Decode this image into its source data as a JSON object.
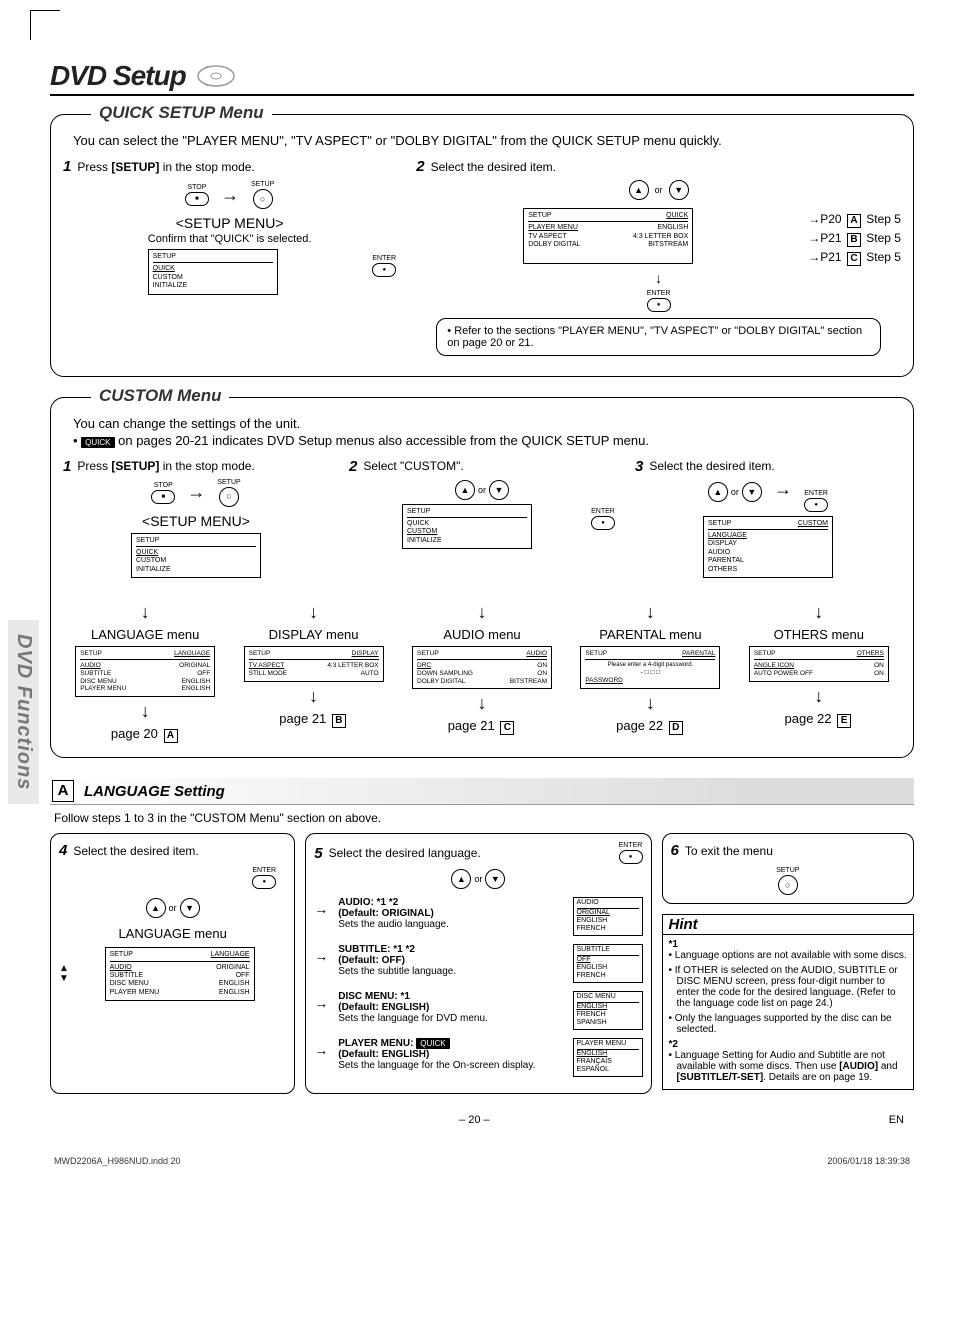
{
  "page": {
    "title": "DVD Setup",
    "sidebar": "DVD Functions",
    "footer_page": "– 20 –",
    "footer_lang": "EN",
    "footer_file": "MWD2206A_H986NUD.indd   20",
    "footer_ts": "2006/01/18   18:39:38"
  },
  "quick": {
    "title": "QUICK SETUP Menu",
    "intro": "You can select the \"PLAYER MENU\", \"TV ASPECT\" or \"DOLBY DIGITAL\" from the QUICK SETUP menu quickly.",
    "step1_num": "1",
    "step1_text_a": "Press ",
    "step1_bold": "[SETUP]",
    "step1_text_b": " in the stop mode.",
    "stop_label": "STOP",
    "setup_label": "SETUP",
    "enter_label": "ENTER",
    "menu_title": "<SETUP MENU>",
    "confirm": "Confirm that \"QUICK\" is selected.",
    "osd1_hdr": "SETUP",
    "osd1_items": [
      "QUICK",
      "CUSTOM",
      "INITIALIZE"
    ],
    "step2_num": "2",
    "step2_text": "Select the desired item.",
    "or": "or",
    "osd2_hdr_l": "SETUP",
    "osd2_hdr_r": "QUICK",
    "osd2_rows": [
      {
        "l": "PLAYER MENU",
        "r": "ENGLISH"
      },
      {
        "l": "TV ASPECT",
        "r": "4:3 LETTER BOX"
      },
      {
        "l": "DOLBY DIGITAL",
        "r": "BITSTREAM"
      }
    ],
    "refs": [
      {
        "p": "P20",
        "box": "A",
        "step": "Step 5"
      },
      {
        "p": "P21",
        "box": "B",
        "step": "Step 5"
      },
      {
        "p": "P21",
        "box": "C",
        "step": "Step 5"
      }
    ],
    "refbox": "Refer to the sections \"PLAYER MENU\", \"TV ASPECT\" or \"DOLBY DIGITAL\" section on page 20 or 21."
  },
  "custom": {
    "title": "CUSTOM Menu",
    "intro1": "You can change the settings of the unit.",
    "intro2a": "",
    "quick_badge": "QUICK",
    "intro2b": " on pages 20-21 indicates DVD Setup menus also accessible from the QUICK SETUP menu.",
    "step1_num": "1",
    "step1_text_a": "Press ",
    "step1_bold": "[SETUP]",
    "step1_text_b": " in the stop mode.",
    "menu_title": "<SETUP MENU>",
    "osd1_hdr": "SETUP",
    "osd1_items": [
      "QUICK",
      "CUSTOM",
      "INITIALIZE"
    ],
    "step2_num": "2",
    "step2_text": "Select \"CUSTOM\".",
    "osd2_hdr": "SETUP",
    "osd2_items": [
      "QUICK",
      "CUSTOM",
      "INITIALIZE"
    ],
    "step3_num": "3",
    "step3_text": "Select the desired item.",
    "osd3_hdr_l": "SETUP",
    "osd3_hdr_r": "CUSTOM",
    "osd3_items": [
      "LANGUAGE",
      "DISPLAY",
      "AUDIO",
      "PARENTAL",
      "OTHERS"
    ],
    "submenus": [
      {
        "title": "LANGUAGE menu",
        "hdr_l": "SETUP",
        "hdr_r": "LANGUAGE",
        "rows": [
          [
            "AUDIO",
            "ORIGINAL"
          ],
          [
            "SUBTITLE",
            "OFF"
          ],
          [
            "DISC MENU",
            "ENGLISH"
          ],
          [
            "PLAYER MENU",
            "ENGLISH"
          ]
        ],
        "page": "page 20",
        "box": "A"
      },
      {
        "title": "DISPLAY menu",
        "hdr_l": "SETUP",
        "hdr_r": "DISPLAY",
        "rows": [
          [
            "TV ASPECT",
            "4:3 LETTER BOX"
          ],
          [
            "STILL MODE",
            "AUTO"
          ]
        ],
        "page": "page 21",
        "box": "B"
      },
      {
        "title": "AUDIO menu",
        "hdr_l": "SETUP",
        "hdr_r": "AUDIO",
        "rows": [
          [
            "DRC",
            "ON"
          ],
          [
            "DOWN SAMPLING",
            "ON"
          ],
          [
            "DOLBY DIGITAL",
            "BITSTREAM"
          ]
        ],
        "page": "page 21",
        "box": "C"
      },
      {
        "title": "PARENTAL menu",
        "hdr_l": "SETUP",
        "hdr_r": "PARENTAL",
        "rows": [
          [
            "PASSWORD",
            ""
          ]
        ],
        "note": "Please enter a 4-digit password.",
        "page": "page 22",
        "box": "D"
      },
      {
        "title": "OTHERS menu",
        "hdr_l": "SETUP",
        "hdr_r": "OTHERS",
        "rows": [
          [
            "ANGLE ICON",
            "ON"
          ],
          [
            "AUTO POWER OFF",
            "ON"
          ]
        ],
        "page": "page 22",
        "box": "E"
      }
    ]
  },
  "lang": {
    "box": "A",
    "heading": "LANGUAGE Setting",
    "follow": "Follow steps 1 to 3 in the \"CUSTOM Menu\" section on above.",
    "step4_num": "4",
    "step4_text": "Select the desired item.",
    "or": "or",
    "menu_title": "LANGUAGE menu",
    "osd_hdr_l": "SETUP",
    "osd_hdr_r": "LANGUAGE",
    "osd_rows": [
      [
        "AUDIO",
        "ORIGINAL"
      ],
      [
        "SUBTITLE",
        "OFF"
      ],
      [
        "DISC MENU",
        "ENGLISH"
      ],
      [
        "PLAYER MENU",
        "ENGLISH"
      ]
    ],
    "step5_num": "5",
    "step5_text": "Select the desired language.",
    "items": [
      {
        "name": "AUDIO: *1 *2",
        "def": "(Default: ORIGINAL)",
        "desc": "Sets the audio language.",
        "osd_hdr": "AUDIO",
        "opts": [
          "ORIGINAL",
          "ENGLISH",
          "FRENCH"
        ]
      },
      {
        "name": "SUBTITLE: *1 *2",
        "def": "(Default: OFF)",
        "desc": "Sets the subtitle language.",
        "osd_hdr": "SUBTITLE",
        "opts": [
          "OFF",
          "ENGLISH",
          "FRENCH"
        ]
      },
      {
        "name": "DISC MENU: *1",
        "def": "(Default: ENGLISH)",
        "desc": "Sets the language for DVD menu.",
        "osd_hdr": "DISC MENU",
        "opts": [
          "ENGLISH",
          "FRENCH",
          "SPANISH"
        ]
      },
      {
        "name": "PLAYER MENU:",
        "badge": "QUICK",
        "def": "(Default: ENGLISH)",
        "desc": "Sets the language for the On-screen display.",
        "osd_hdr": "PLAYER MENU",
        "opts": [
          "ENGLISH",
          "FRANÇAIS",
          "ESPAÑOL"
        ]
      }
    ],
    "step6_num": "6",
    "step6_text": "To exit the menu",
    "hint_title": "Hint",
    "hint_star1": "*1",
    "hint1": "Language options are not available with some discs.",
    "hint2": "If OTHER is selected on the AUDIO, SUBTITLE or DISC MENU screen, press four-digit number to enter the code for the desired language. (Refer to the language code list on page 24.)",
    "hint3": "Only the languages supported by the disc can be selected.",
    "hint_star2": "*2",
    "hint4a": "Language Setting for Audio and Subtitle are not available with some discs. Then use ",
    "hint4b": "[AUDIO]",
    "hint4c": " and ",
    "hint4d": "[SUBTITLE/T-SET]",
    "hint4e": ". Details are on page 19."
  }
}
